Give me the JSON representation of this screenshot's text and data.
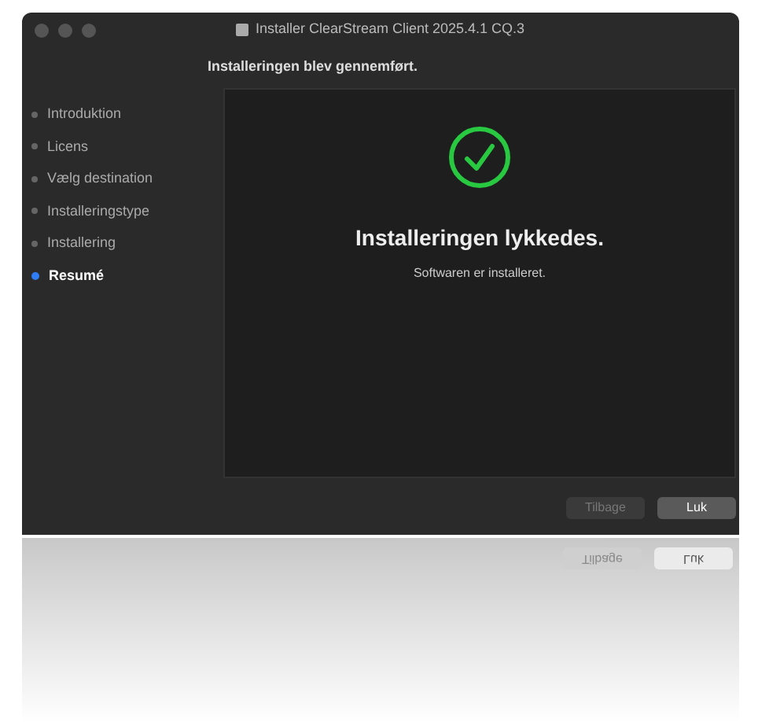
{
  "window": {
    "title": "Installer ClearStream Client 2025.4.1 CQ.3"
  },
  "heading": "Installeringen blev gennemført.",
  "sidebar": {
    "items": [
      {
        "label": "Introduktion",
        "selected": false
      },
      {
        "label": "Licens",
        "selected": false
      },
      {
        "label": "Vælg destination",
        "selected": false
      },
      {
        "label": "Installeringstype",
        "selected": false
      },
      {
        "label": "Installering",
        "selected": false
      },
      {
        "label": "Resumé",
        "selected": true
      }
    ]
  },
  "content": {
    "title": "Installeringen lykkedes.",
    "subtitle": "Softwaren er installeret."
  },
  "buttons": [
    {
      "label": "Tilbage",
      "disabled": true
    },
    {
      "label": "Luk",
      "disabled": false
    }
  ],
  "reflection": {
    "buttons": [
      {
        "label": "Tilbage",
        "disabled": true
      },
      {
        "label": "Luk",
        "disabled": false
      }
    ]
  }
}
